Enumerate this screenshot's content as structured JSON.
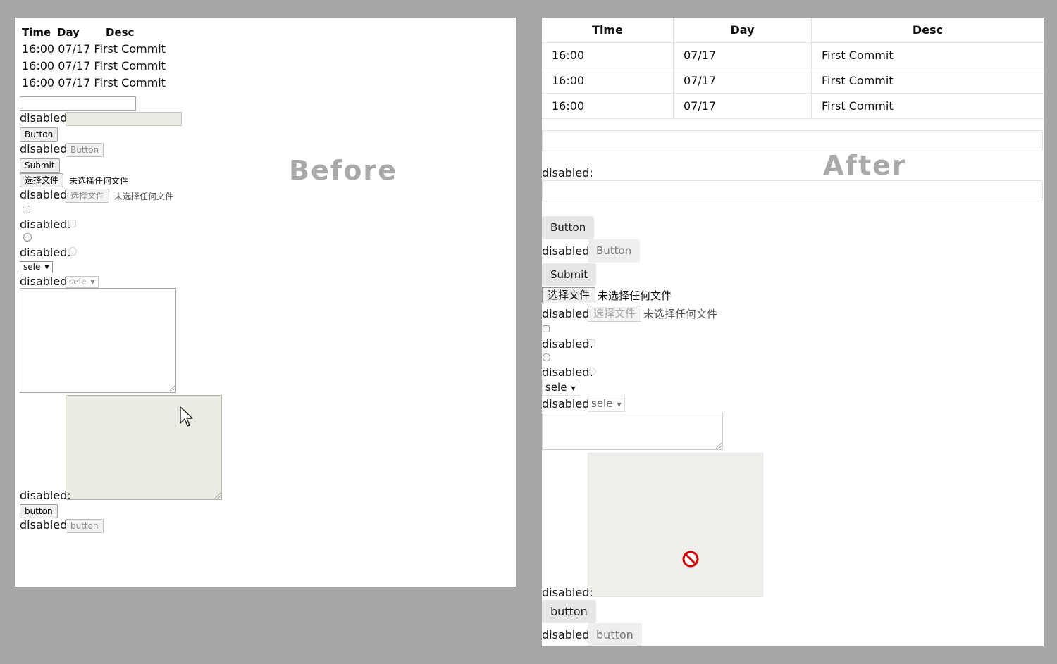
{
  "table": {
    "headers": [
      "Time",
      "Day",
      "Desc"
    ],
    "rows": [
      [
        "16:00",
        "07/17",
        "First Commit"
      ],
      [
        "16:00",
        "07/17",
        "First Commit"
      ],
      [
        "16:00",
        "07/17",
        "First Commit"
      ]
    ]
  },
  "before": {
    "watermark": "Before",
    "disabled_label": "disabled:",
    "button_label": "Button",
    "submit_label": "Submit",
    "file_button_label": "选择文件",
    "file_status": "未选择任何文件",
    "select_value": "sele",
    "lower_button_label": "button"
  },
  "after": {
    "watermark": "After",
    "disabled_label": "disabled:",
    "button_label": "Button",
    "submit_label": "Submit",
    "file_button_label": "选择文件",
    "file_status": "未选择任何文件",
    "select_value": "sele",
    "lower_button_label": "button"
  },
  "colors": {
    "background": "#a6a6a6",
    "panel": "#ffffff",
    "watermark": "#a9a9a9",
    "not_allowed_cursor": "#cc0000"
  },
  "icons": {
    "caret": "triangle-down",
    "cursor": "arrow-pointer",
    "not_allowed": "not-allowed-circle"
  }
}
